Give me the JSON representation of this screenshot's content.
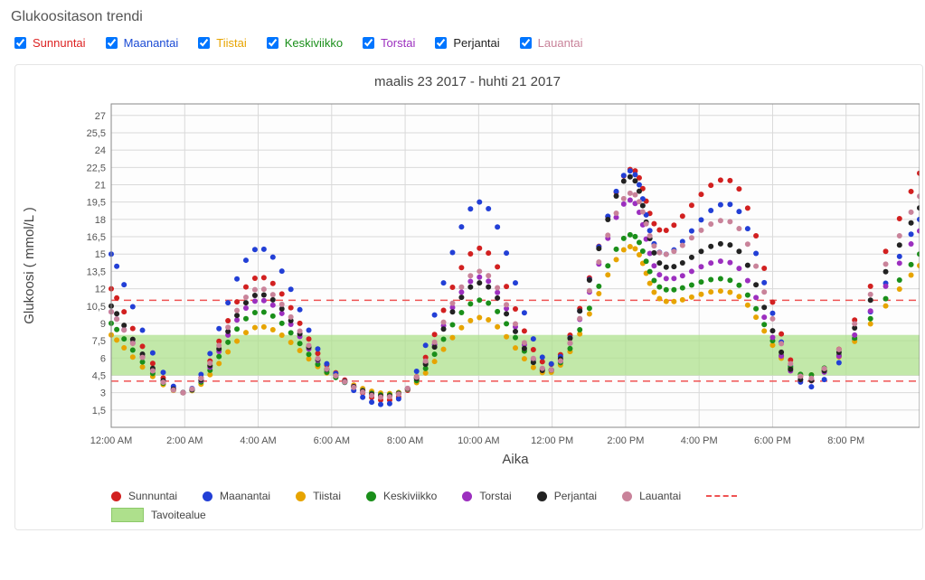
{
  "title": "Glukoositason trendi",
  "filters": [
    {
      "key": "sun",
      "label": "Sunnuntai",
      "checked": true,
      "color": "#d22"
    },
    {
      "key": "mon",
      "label": "Maanantai",
      "checked": true,
      "color": "#1a4ad4"
    },
    {
      "key": "tue",
      "label": "Tiistai",
      "checked": true,
      "color": "#e7a400"
    },
    {
      "key": "wed",
      "label": "Keskiviikko",
      "checked": true,
      "color": "#1a8f1a"
    },
    {
      "key": "thu",
      "label": "Torstai",
      "checked": true,
      "color": "#9c2fbf"
    },
    {
      "key": "fri",
      "label": "Perjantai",
      "checked": true,
      "color": "#222"
    },
    {
      "key": "sat",
      "label": "Lauantai",
      "checked": true,
      "color": "#c9839a"
    }
  ],
  "chart_data": {
    "type": "scatter",
    "title": "maalis 23 2017 - huhti 21 2017",
    "xlabel": "Aika",
    "ylabel": "Glukoosi ( mmol/L )",
    "ylim": [
      0,
      28
    ],
    "y_ticks": [
      1.5,
      3,
      4.5,
      6,
      7.5,
      9,
      10.5,
      12,
      13.5,
      15,
      16.5,
      18,
      19.5,
      21,
      22.5,
      24,
      25.5,
      27
    ],
    "y_tick_labels": [
      "1,5",
      "3",
      "4,5",
      "6",
      "7,5",
      "9",
      "10,5",
      "12",
      "13,5",
      "15",
      "16,5",
      "18",
      "19,5",
      "21",
      "22,5",
      "24",
      "25,5",
      "27"
    ],
    "x_domain_hours": [
      0,
      22
    ],
    "x_tick_hours": [
      0,
      2,
      4,
      6,
      8,
      10,
      12,
      14,
      16,
      18,
      20
    ],
    "x_tick_labels": [
      "12:00 AM",
      "2:00 AM",
      "4:00 AM",
      "6:00 AM",
      "8:00 AM",
      "10:00 AM",
      "12:00 PM",
      "2:00 PM",
      "4:00 PM",
      "6:00 PM",
      "8:00 PM"
    ],
    "target_band": [
      4.5,
      8
    ],
    "reference_lines": [
      4,
      11
    ],
    "series": [
      {
        "name": "Sunnuntai",
        "color": "#d22020",
        "anchors": [
          [
            0,
            12
          ],
          [
            2,
            3
          ],
          [
            4,
            13
          ],
          [
            6,
            5
          ],
          [
            8,
            3
          ],
          [
            10,
            15.5
          ],
          [
            12,
            5.5
          ],
          [
            14,
            22
          ],
          [
            15,
            17
          ],
          [
            17,
            21
          ],
          [
            19,
            4
          ],
          [
            22,
            22
          ]
        ]
      },
      {
        "name": "Maanantai",
        "color": "#223fd6",
        "anchors": [
          [
            0,
            15
          ],
          [
            2,
            3
          ],
          [
            4,
            15.5
          ],
          [
            6,
            5
          ],
          [
            8,
            3
          ],
          [
            10,
            19.5
          ],
          [
            12,
            5.5
          ],
          [
            14,
            22
          ],
          [
            15,
            15
          ],
          [
            17,
            19
          ],
          [
            19,
            3.5
          ],
          [
            22,
            18
          ]
        ]
      },
      {
        "name": "Tiistai",
        "color": "#e7a400",
        "anchors": [
          [
            0,
            8
          ],
          [
            2,
            3
          ],
          [
            4,
            8.7
          ],
          [
            6,
            4.5
          ],
          [
            8,
            3.2
          ],
          [
            10,
            9.5
          ],
          [
            12,
            4.8
          ],
          [
            14,
            15.5
          ],
          [
            15,
            11
          ],
          [
            17,
            11.5
          ],
          [
            19,
            4.5
          ],
          [
            22,
            14
          ]
        ]
      },
      {
        "name": "Keskiviikko",
        "color": "#1a8f1a",
        "anchors": [
          [
            0,
            9
          ],
          [
            2,
            3
          ],
          [
            4,
            10
          ],
          [
            6,
            4.5
          ],
          [
            8,
            3.2
          ],
          [
            10,
            11
          ],
          [
            12,
            5
          ],
          [
            14,
            16.5
          ],
          [
            15,
            12
          ],
          [
            17,
            12.5
          ],
          [
            19,
            4.5
          ],
          [
            22,
            15
          ]
        ]
      },
      {
        "name": "Torstai",
        "color": "#9c2fbf",
        "anchors": [
          [
            0,
            10
          ],
          [
            2,
            3
          ],
          [
            4,
            11
          ],
          [
            6,
            4.7
          ],
          [
            8,
            3.2
          ],
          [
            10,
            13
          ],
          [
            12,
            5
          ],
          [
            14,
            19.5
          ],
          [
            15,
            13
          ],
          [
            17,
            14
          ],
          [
            19,
            4
          ],
          [
            22,
            17
          ]
        ]
      },
      {
        "name": "Perjantai",
        "color": "#222222",
        "anchors": [
          [
            0,
            10.5
          ],
          [
            2,
            3
          ],
          [
            4,
            11.5
          ],
          [
            6,
            4.7
          ],
          [
            8,
            3.2
          ],
          [
            10,
            12.5
          ],
          [
            12,
            5
          ],
          [
            14,
            21.5
          ],
          [
            15,
            14
          ],
          [
            17,
            15.5
          ],
          [
            19,
            4
          ],
          [
            22,
            19
          ]
        ]
      },
      {
        "name": "Lauantai",
        "color": "#c9839a",
        "anchors": [
          [
            0,
            10
          ],
          [
            2,
            3
          ],
          [
            4,
            12
          ],
          [
            6,
            4.7
          ],
          [
            8,
            3.2
          ],
          [
            10,
            13.5
          ],
          [
            12,
            5
          ],
          [
            14,
            20
          ],
          [
            15,
            15
          ],
          [
            17,
            17.5
          ],
          [
            19,
            4.2
          ],
          [
            22,
            20
          ]
        ]
      }
    ]
  },
  "legend": {
    "items": [
      {
        "label": "Sunnuntai",
        "color": "#d22020"
      },
      {
        "label": "Maanantai",
        "color": "#223fd6"
      },
      {
        "label": "Tiistai",
        "color": "#e7a400"
      },
      {
        "label": "Keskiviikko",
        "color": "#1a8f1a"
      },
      {
        "label": "Torstai",
        "color": "#9c2fbf"
      },
      {
        "label": "Perjantai",
        "color": "#222222"
      },
      {
        "label": "Lauantai",
        "color": "#c9839a"
      }
    ],
    "target_label": "Tavoitealue"
  }
}
